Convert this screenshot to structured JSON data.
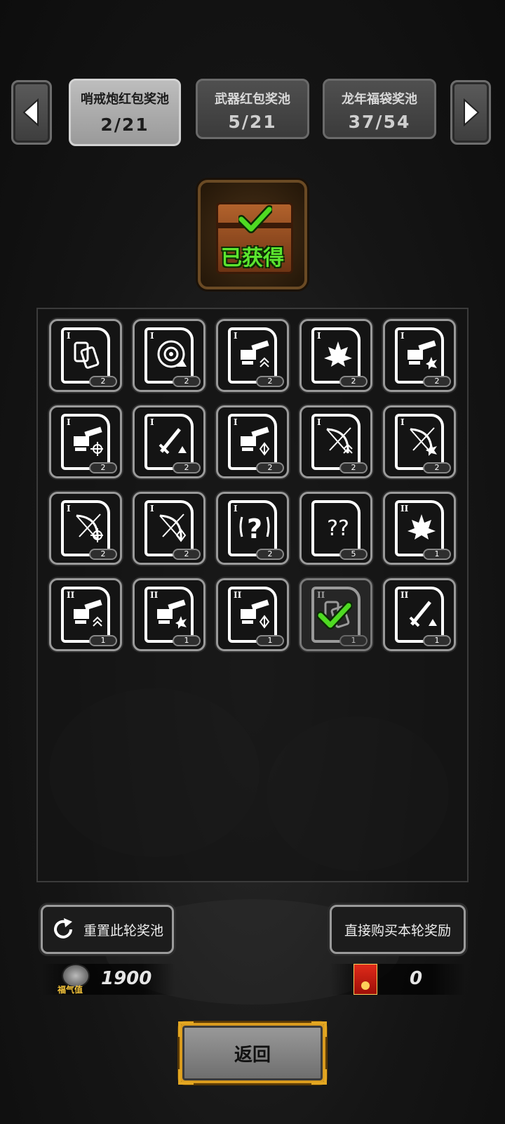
{
  "tabs": [
    {
      "name": "哨戒炮红包奖池",
      "progress": "2/21",
      "active": true
    },
    {
      "name": "武器红包奖池",
      "progress": "5/21",
      "active": false
    },
    {
      "name": "龙年福袋奖池",
      "progress": "37/54",
      "active": false
    }
  ],
  "chest": {
    "status_label": "已获得"
  },
  "rewards": [
    {
      "tier": "I",
      "icon": "cards-icon",
      "count": "2"
    },
    {
      "tier": "I",
      "icon": "target-icon",
      "count": "2"
    },
    {
      "tier": "I",
      "icon": "turret-chevrons-icon",
      "count": "2"
    },
    {
      "tier": "I",
      "icon": "maple-leaf-icon",
      "count": "2"
    },
    {
      "tier": "I",
      "icon": "turret-burst-icon",
      "count": "2"
    },
    {
      "tier": "I",
      "icon": "turret-crosshair-icon",
      "count": "2"
    },
    {
      "tier": "I",
      "icon": "sword-icon",
      "count": "2"
    },
    {
      "tier": "I",
      "icon": "turret-diamond-icon",
      "count": "2"
    },
    {
      "tier": "I",
      "icon": "bow-chevrons-icon",
      "count": "2"
    },
    {
      "tier": "I",
      "icon": "bow-burst-icon",
      "count": "2"
    },
    {
      "tier": "I",
      "icon": "bow-crosshair-icon",
      "count": "2"
    },
    {
      "tier": "I",
      "icon": "bow-diamond-icon",
      "count": "2"
    },
    {
      "tier": "I",
      "icon": "question-mark-icon",
      "count": "2"
    },
    {
      "tier": "",
      "icon": "double-question-icon",
      "count": "5"
    },
    {
      "tier": "II",
      "icon": "maple-leaf-icon",
      "count": "1"
    },
    {
      "tier": "II",
      "icon": "turret-chevrons-icon",
      "count": "1"
    },
    {
      "tier": "II",
      "icon": "turret-burst-icon",
      "count": "1"
    },
    {
      "tier": "II",
      "icon": "turret-diamond-icon",
      "count": "1"
    },
    {
      "tier": "II",
      "icon": "cards-icon",
      "count": "1",
      "claimed": true
    },
    {
      "tier": "II",
      "icon": "sword-icon",
      "count": "1"
    }
  ],
  "reset_button": {
    "label": "重置此轮奖池",
    "icon": "refresh-icon"
  },
  "buy_button": {
    "label": "直接购买本轮奖励"
  },
  "fortune": {
    "caption": "福气值",
    "value": "1900"
  },
  "red_packet": {
    "value": "0"
  },
  "back_button": {
    "label": "返回"
  },
  "colors": {
    "claimed_check": "#4fdb22",
    "back_border": "#d99b1e"
  }
}
